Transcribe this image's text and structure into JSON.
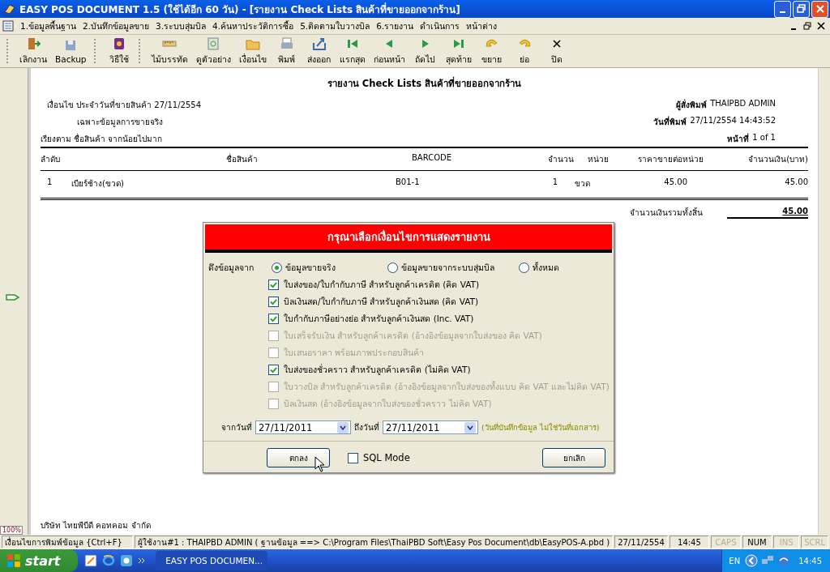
{
  "window": {
    "title": "EASY POS DOCUMENT 1.5 (ใช้ได้อีก 60 วัน) - [รายงาน Check Lists สินค้าที่ขายออกจากร้าน]"
  },
  "menu": [
    "1.ข้อมูลพื้นฐาน",
    "2.บันทึกข้อมูลขาย",
    "3.ระบบสุ่มบิล",
    "4.ค้นหาประวัติการซื้อ",
    "5.ติดตามใบวางบิล",
    "6.รายงาน",
    "ดำเนินการ",
    "หน้าต่าง"
  ],
  "toolbar": [
    {
      "label": "เลิกงาน"
    },
    {
      "label": "Backup"
    },
    {
      "label": "วิธีใช้"
    },
    {
      "label": "ไม้บรรทัด"
    },
    {
      "label": "ดูตัวอย่าง"
    },
    {
      "label": "เงื่อนไข"
    },
    {
      "label": "พิมพ์"
    },
    {
      "label": "ส่งออก"
    },
    {
      "label": "แรกสุด"
    },
    {
      "label": "ก่อนหน้า"
    },
    {
      "label": "ถัดไป"
    },
    {
      "label": "สุดท้าย"
    },
    {
      "label": "ขยาย"
    },
    {
      "label": "ย่อ"
    },
    {
      "label": "ปิด"
    }
  ],
  "zoom": "100%",
  "report": {
    "title": "รายงาน Check Lists สินค้าที่ขายออกจากร้าน",
    "condition_lines": [
      "เงื่อนไข ประจำวันที่ขายสินค้า 27/11/2554",
      "เฉพาะข้อมูลการขายจริง"
    ],
    "printed_by": {
      "label": "ผู้สั่งพิมพ์",
      "value": "THAIPBD  ADMIN"
    },
    "print_date": {
      "label": "วันที่พิมพ์",
      "value": "27/11/2554 14:43:52"
    },
    "sort": "เรียงตาม ชื่อสินค้า จากน้อยไปมาก",
    "page": {
      "label": "หน้าที่",
      "value": "1 of 1"
    },
    "columns": [
      "ลำดับ",
      "ชื่อสินค้า",
      "BARCODE",
      "จำนวน",
      "หน่วย",
      "ราคาขายต่อหน่วย",
      "จำนวนเงิน(บาท)"
    ],
    "rows": [
      [
        "1",
        "เบียร์ช้าง(ขวด)",
        "B01-1",
        "1",
        "ขวด",
        "45.00",
        "45.00"
      ]
    ],
    "total": {
      "label": "จำนวนเงินรวมทั้งสิ้น",
      "value": "45.00"
    },
    "footer": "บริษัท ไทยพีบีดี คอทคอม จำกัด"
  },
  "dialog": {
    "title": "กรุณาเลือกเงื่อนไขการแสดงรายงาน",
    "source_label": "ดึงข้อมูลจาก",
    "sources": [
      {
        "label": "ข้อมูลขายจริง",
        "selected": true
      },
      {
        "label": "ข้อมูลขายจากระบบสุ่มบิล",
        "selected": false
      },
      {
        "label": "ทั้งหมด",
        "selected": false
      }
    ],
    "options": [
      {
        "label": "ใบส่งของ/ใบกำกับภาษี สำหรับลูกค้าเครดิต (คิด VAT)",
        "checked": true,
        "disabled": false
      },
      {
        "label": "บิลเงินสด/ใบกำกับภาษี สำหรับลูกค้าเงินสด (คิด VAT)",
        "checked": true,
        "disabled": false
      },
      {
        "label": "ใบกำกับภาษีอย่างย่อ สำหรับลูกค้าเงินสด (Inc. VAT)",
        "checked": true,
        "disabled": false
      },
      {
        "label": "ใบเสร็จรับเงิน สำหรับลูกค้าเครดิต (อ้างอิงข้อมูลจากใบส่งของ คิด VAT)",
        "checked": false,
        "disabled": true
      },
      {
        "label": "ใบเสนอราคา พร้อมภาพประกอบสินค้า",
        "checked": false,
        "disabled": true
      },
      {
        "label": "ใบส่งของชั่วคราว สำหรับลูกค้าเครดิต (ไม่คิด VAT)",
        "checked": true,
        "disabled": false
      },
      {
        "label": "ใบวางบิล สำหรับลูกค้าเครดิต (อ้างอิงข้อมูลจากใบส่งของทั้งแบบ คิด VAT และไม่คิด VAT)",
        "checked": false,
        "disabled": true
      },
      {
        "label": "บิลเงินสด (อ้างอิงข้อมูลจากใบส่งของชั่วคราว ไม่คิด VAT)",
        "checked": false,
        "disabled": true
      }
    ],
    "from": {
      "label": "จากวันที่",
      "value": "27/11/2011"
    },
    "to": {
      "label": "ถึงวันที่",
      "value": "27/11/2011"
    },
    "date_note": "(วันที่บันทึกข้อมูล ไม่ใช่วันที่เอกสาร)",
    "ok": "ตกลง",
    "sql_mode": {
      "label": "SQL Mode",
      "checked": false
    },
    "cancel": "ยกเลิก"
  },
  "status_bar": [
    {
      "text": "เงื่อนไขการพิมพ์ข้อมูล {Ctrl+F}",
      "disabled": false
    },
    {
      "text": "ผู้ใช้งาน#1 : THAIPBD  ADMIN ( ฐานข้อมูล ==> C:\\Program Files\\ThaiPBD Soft\\Easy Pos Document\\db\\EasyPOS-A.pbd )",
      "disabled": false
    },
    {
      "text": "27/11/2554",
      "disabled": false
    },
    {
      "text": "14:45",
      "disabled": false
    },
    {
      "text": "CAPS",
      "disabled": true
    },
    {
      "text": "NUM",
      "disabled": false
    },
    {
      "text": "INS",
      "disabled": true
    },
    {
      "text": "SCRL",
      "disabled": true
    }
  ],
  "taskbar": {
    "start": "start",
    "task": "EASY POS DOCUMEN...",
    "language": "EN",
    "clock": "14:45"
  }
}
